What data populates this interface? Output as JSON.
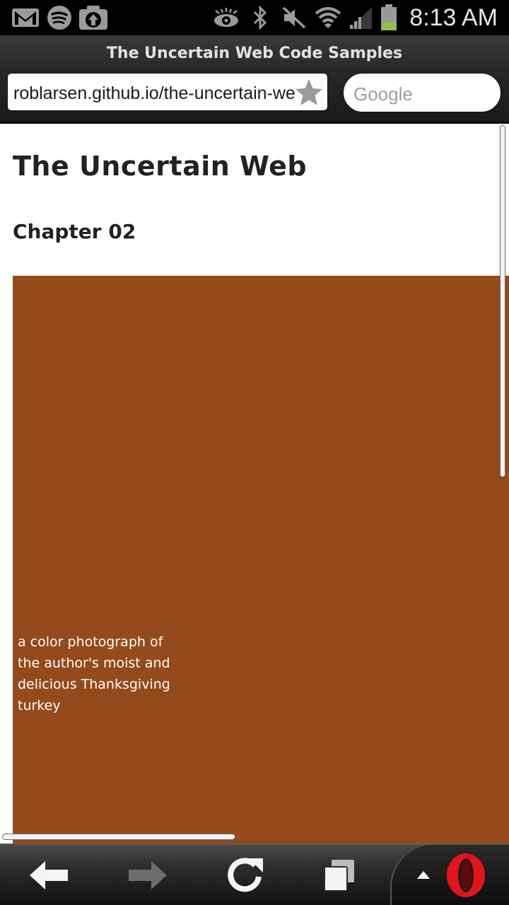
{
  "status_bar": {
    "time": "8:13 AM",
    "icons": [
      "gmail-icon",
      "spotify-icon",
      "upload-icon",
      "eye-icon",
      "bluetooth-icon",
      "mute-icon",
      "wifi-icon",
      "signal-icon",
      "battery-icon"
    ],
    "battery_color": "#8dc63f"
  },
  "browser": {
    "page_title": "The Uncertain Web Code Samples",
    "url": "roblarsen.github.io/the-uncertain-web",
    "search_placeholder": "Google"
  },
  "page": {
    "heading": "The Uncertain Web",
    "subheading": "Chapter 02",
    "image_alt": "a color photograph of the author's moist and delicious Thanksgiving turkey",
    "image_bg_color": "#944a1b"
  },
  "toolbar": {
    "buttons": [
      "back-icon",
      "forward-icon",
      "reload-icon",
      "tabs-icon",
      "menu-arrow-icon",
      "opera-icon"
    ]
  }
}
